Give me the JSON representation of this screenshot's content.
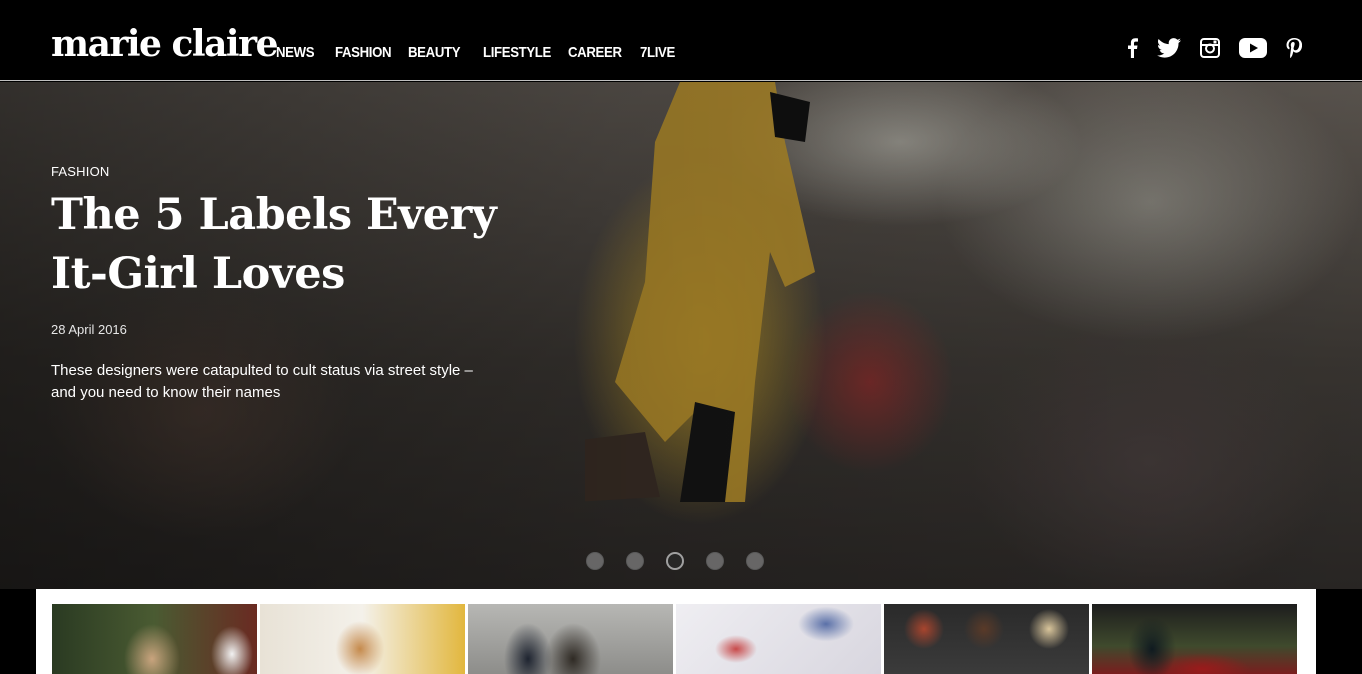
{
  "brand": {
    "logo_text": "marie claire"
  },
  "nav": {
    "items": [
      "NEWS",
      "FASHION",
      "BEAUTY",
      "LIFESTYLE",
      "CAREER",
      "7LIVE"
    ]
  },
  "social": [
    "facebook-icon",
    "twitter-icon",
    "instagram-icon",
    "youtube-icon",
    "pinterest-icon"
  ],
  "hero": {
    "category": "FASHION",
    "title_line1": "The 5 Labels Every",
    "title_line2": "It-Girl Loves",
    "date": "28 April 2016",
    "description": "These designers were catapulted to cult status via street style – and you need to know their names"
  },
  "slider": {
    "count": 5,
    "active_index": 2
  },
  "thumbnails": [
    {
      "name": "red-carpet-gold-dress"
    },
    {
      "name": "tv-week-logies"
    },
    {
      "name": "street-style-couple"
    },
    {
      "name": "beauty-products-flatlay"
    },
    {
      "name": "sex-and-the-city-cast"
    },
    {
      "name": "met-gala-red-carpet"
    }
  ],
  "colors": {
    "header_bg": "#000000",
    "text": "#ffffff",
    "strip_bg": "#ffffff"
  }
}
